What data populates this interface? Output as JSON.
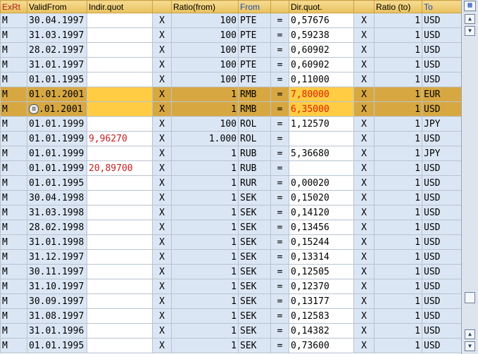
{
  "columns": [
    "ExRt",
    "ValidFrom",
    "Indir.quot",
    "",
    "Ratio(from)",
    "From",
    "",
    "Dir.quot.",
    "",
    "Ratio (to)",
    "To"
  ],
  "rows": [
    {
      "exrt": "M",
      "valid": "30.04.1997",
      "indir": "",
      "x1": "X",
      "rfrom": "100",
      "from": "PTE",
      "eq": "=",
      "dir": "0,57676",
      "x2": "X",
      "rto": "1",
      "to": "USD"
    },
    {
      "exrt": "M",
      "valid": "31.03.1997",
      "indir": "",
      "x1": "X",
      "rfrom": "100",
      "from": "PTE",
      "eq": "=",
      "dir": "0,59238",
      "x2": "X",
      "rto": "1",
      "to": "USD"
    },
    {
      "exrt": "M",
      "valid": "28.02.1997",
      "indir": "",
      "x1": "X",
      "rfrom": "100",
      "from": "PTE",
      "eq": "=",
      "dir": "0,60902",
      "x2": "X",
      "rto": "1",
      "to": "USD"
    },
    {
      "exrt": "M",
      "valid": "31.01.1997",
      "indir": "",
      "x1": "X",
      "rfrom": "100",
      "from": "PTE",
      "eq": "=",
      "dir": "0,60902",
      "x2": "X",
      "rto": "1",
      "to": "USD"
    },
    {
      "exrt": "M",
      "valid": "01.01.1995",
      "indir": "",
      "x1": "X",
      "rfrom": "100",
      "from": "PTE",
      "eq": "=",
      "dir": "0,11000",
      "x2": "X",
      "rto": "1",
      "to": "USD"
    },
    {
      "exrt": "M",
      "valid": "01.01.2001",
      "indir": "",
      "x1": "X",
      "rfrom": "1",
      "from": "RMB",
      "eq": "=",
      "dir": "7,80000",
      "x2": "X",
      "rto": "1",
      "to": "EUR",
      "selected": true
    },
    {
      "exrt": "M",
      "valid": ".01.2001",
      "indir": "",
      "x1": "X",
      "rfrom": "1",
      "from": "RMB",
      "eq": "=",
      "dir": "6,35000",
      "x2": "X",
      "rto": "1",
      "to": "USD",
      "selected": true,
      "tool": true
    },
    {
      "exrt": "M",
      "valid": "01.01.1999",
      "indir": "",
      "x1": "X",
      "rfrom": "100",
      "from": "ROL",
      "eq": "=",
      "dir": "1,12570",
      "x2": "X",
      "rto": "1",
      "to": "JPY"
    },
    {
      "exrt": "M",
      "valid": "01.01.1999",
      "indir": "9,96270",
      "x1": "X",
      "rfrom": "1.000",
      "from": "ROL",
      "eq": "=",
      "dir": "",
      "x2": "X",
      "rto": "1",
      "to": "USD"
    },
    {
      "exrt": "M",
      "valid": "01.01.1999",
      "indir": "",
      "x1": "X",
      "rfrom": "1",
      "from": "RUB",
      "eq": "=",
      "dir": "5,36680",
      "x2": "X",
      "rto": "1",
      "to": "JPY"
    },
    {
      "exrt": "M",
      "valid": "01.01.1999",
      "indir": "20,89700",
      "x1": "X",
      "rfrom": "1",
      "from": "RUB",
      "eq": "=",
      "dir": "",
      "x2": "X",
      "rto": "1",
      "to": "USD"
    },
    {
      "exrt": "M",
      "valid": "01.01.1995",
      "indir": "",
      "x1": "X",
      "rfrom": "1",
      "from": "RUR",
      "eq": "=",
      "dir": "0,00020",
      "x2": "X",
      "rto": "1",
      "to": "USD"
    },
    {
      "exrt": "M",
      "valid": "30.04.1998",
      "indir": "",
      "x1": "X",
      "rfrom": "1",
      "from": "SEK",
      "eq": "=",
      "dir": "0,15020",
      "x2": "X",
      "rto": "1",
      "to": "USD"
    },
    {
      "exrt": "M",
      "valid": "31.03.1998",
      "indir": "",
      "x1": "X",
      "rfrom": "1",
      "from": "SEK",
      "eq": "=",
      "dir": "0,14120",
      "x2": "X",
      "rto": "1",
      "to": "USD"
    },
    {
      "exrt": "M",
      "valid": "28.02.1998",
      "indir": "",
      "x1": "X",
      "rfrom": "1",
      "from": "SEK",
      "eq": "=",
      "dir": "0,13456",
      "x2": "X",
      "rto": "1",
      "to": "USD"
    },
    {
      "exrt": "M",
      "valid": "31.01.1998",
      "indir": "",
      "x1": "X",
      "rfrom": "1",
      "from": "SEK",
      "eq": "=",
      "dir": "0,15244",
      "x2": "X",
      "rto": "1",
      "to": "USD"
    },
    {
      "exrt": "M",
      "valid": "31.12.1997",
      "indir": "",
      "x1": "X",
      "rfrom": "1",
      "from": "SEK",
      "eq": "=",
      "dir": "0,13314",
      "x2": "X",
      "rto": "1",
      "to": "USD"
    },
    {
      "exrt": "M",
      "valid": "30.11.1997",
      "indir": "",
      "x1": "X",
      "rfrom": "1",
      "from": "SEK",
      "eq": "=",
      "dir": "0,12505",
      "x2": "X",
      "rto": "1",
      "to": "USD"
    },
    {
      "exrt": "M",
      "valid": "31.10.1997",
      "indir": "",
      "x1": "X",
      "rfrom": "1",
      "from": "SEK",
      "eq": "=",
      "dir": "0,12370",
      "x2": "X",
      "rto": "1",
      "to": "USD"
    },
    {
      "exrt": "M",
      "valid": "30.09.1997",
      "indir": "",
      "x1": "X",
      "rfrom": "1",
      "from": "SEK",
      "eq": "=",
      "dir": "0,13177",
      "x2": "X",
      "rto": "1",
      "to": "USD"
    },
    {
      "exrt": "M",
      "valid": "31.08.1997",
      "indir": "",
      "x1": "X",
      "rfrom": "1",
      "from": "SEK",
      "eq": "=",
      "dir": "0,12583",
      "x2": "X",
      "rto": "1",
      "to": "USD"
    },
    {
      "exrt": "M",
      "valid": "31.01.1996",
      "indir": "",
      "x1": "X",
      "rfrom": "1",
      "from": "SEK",
      "eq": "=",
      "dir": "0,14382",
      "x2": "X",
      "rto": "1",
      "to": "USD"
    },
    {
      "exrt": "M",
      "valid": "01.01.1995",
      "indir": "",
      "x1": "X",
      "rfrom": "1",
      "from": "SEK",
      "eq": "=",
      "dir": "0,73600",
      "x2": "X",
      "rto": "1",
      "to": "USD"
    }
  ],
  "scrollbar": {
    "up_icon": "▲",
    "down_icon": "▼",
    "config_icon": "table-settings-icon"
  }
}
